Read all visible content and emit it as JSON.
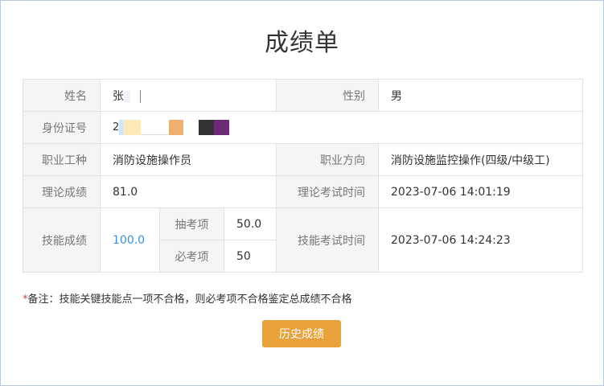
{
  "title": "成绩单",
  "rows": {
    "name_label": "姓名",
    "name_value": "张",
    "gender_label": "性别",
    "gender_value": "男",
    "id_label": "身份证号",
    "id_value_prefix": "2",
    "job_label": "职业工种",
    "job_value": "消防设施操作员",
    "direction_label": "职业方向",
    "direction_value": "消防设施监控操作(四级/中级工)",
    "theory_label": "理论成绩",
    "theory_value": "81.0",
    "theory_time_label": "理论考试时间",
    "theory_time_value": "2023-07-06 14:01:19",
    "skill_label": "技能成绩",
    "skill_value": "100.0",
    "sample_label": "抽考项",
    "sample_value": "50.0",
    "required_label": "必考项",
    "required_value": "50",
    "skill_time_label": "技能考试时间",
    "skill_time_value": "2023-07-06 14:24:23"
  },
  "note": {
    "star": "*",
    "text": "备注：技能关键技能点一项不合格，则必考项不合格鉴定总成绩不合格"
  },
  "button": {
    "label": "历史成绩"
  },
  "colors": {
    "accent_button": "#e9a23b",
    "skill_score": "#3a8ee6",
    "label_bg": "#f5f5f5",
    "border": "#e2e2e2",
    "note_star": "#e53935"
  }
}
